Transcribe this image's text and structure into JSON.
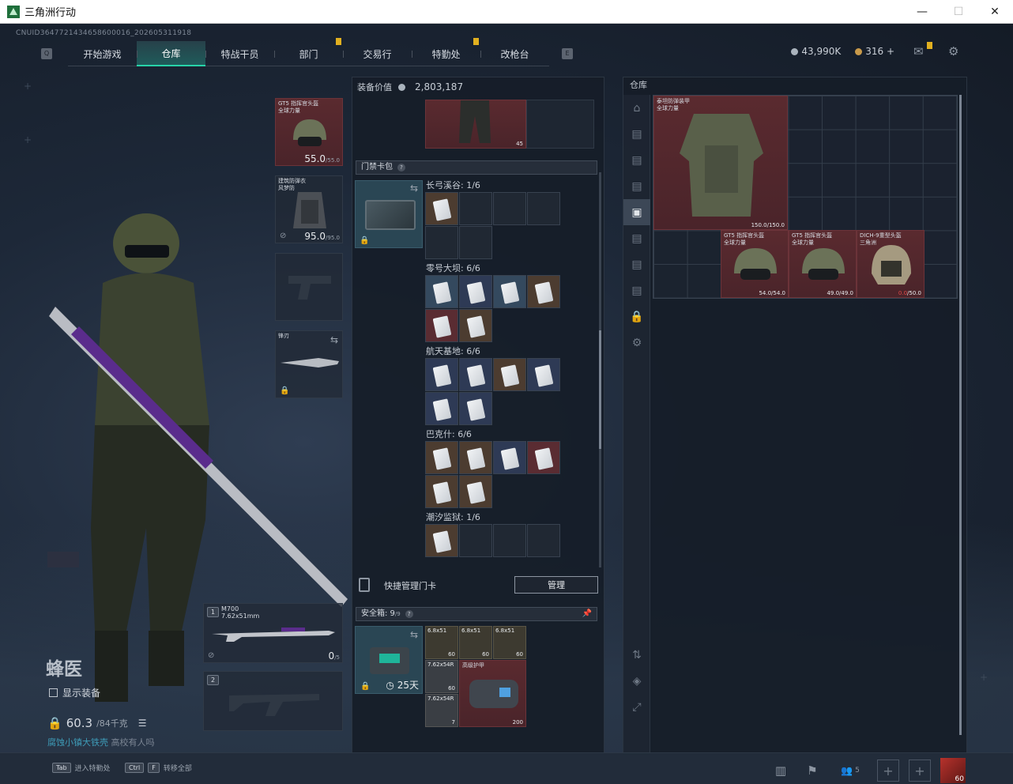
{
  "window": {
    "title": "三角洲行动",
    "minimize": "—",
    "maximize": "☐",
    "close": "✕"
  },
  "uid": "CNUID364772143465860001​6_202605311918",
  "nav": {
    "tabs": [
      {
        "label": "开始游戏",
        "badge": false
      },
      {
        "label": "仓库",
        "badge": false,
        "active": true
      },
      {
        "label": "特战干员",
        "badge": false
      },
      {
        "label": "部门",
        "badge": true
      },
      {
        "label": "交易行",
        "badge": false
      },
      {
        "label": "特勤处",
        "badge": true
      },
      {
        "label": "改枪台",
        "badge": false
      }
    ],
    "left_key": "Q",
    "right_key": "E"
  },
  "currency": {
    "silver": "43,990K",
    "gold": "316 +"
  },
  "character": {
    "name": "蜂医",
    "show_gear": "显示装备",
    "weight": "60.3",
    "weight_unit": "/84千克",
    "status": "腐蚀小镇大铁壳 ",
    "status_extra": "高校有人吗"
  },
  "gear": {
    "helmet": {
      "tag": "GT5 指挥官头盔\n全球力量",
      "dur": "55.0",
      "max": "/55.0"
    },
    "armor": {
      "tag": "建筑防弹衣\n风梦防",
      "dur": "95.0",
      "max": "/95.0"
    },
    "melee": {
      "tag": "锋刃"
    },
    "primary": {
      "tag": "M700",
      "sub": "7.62x51mm",
      "ammo": "0",
      "ammo_max": "/5",
      "slot_no": "1"
    },
    "secondary": {
      "slot_no": "2"
    }
  },
  "mid": {
    "title": "装备价值",
    "value": "2,803,187",
    "keycard_section": "门禁卡包",
    "maps": [
      {
        "label": "长弓溪谷: 1/6"
      },
      {
        "label": "零号大坝: 6/6"
      },
      {
        "label": "航天基地: 6/6"
      },
      {
        "label": "巴克什: 6/6"
      },
      {
        "label": "潮汐监狱: 1/6"
      }
    ],
    "top_count": "45",
    "manage_label": "快捷管理门卡",
    "manage_btn": "管理",
    "safe_title": "安全箱: 9",
    "safe_max": "/9",
    "safe_days": "25天",
    "ammo": [
      {
        "name": "6.8x51",
        "count": "60"
      },
      {
        "name": "6.8x51",
        "count": "60"
      },
      {
        "name": "6.8x51",
        "count": "60"
      },
      {
        "name": "7.62x54R",
        "count": "60"
      },
      {
        "name": "7.62x54R",
        "count": "7"
      }
    ],
    "safe_item": {
      "name": "高级护甲",
      "count": "200"
    }
  },
  "warehouse": {
    "title": "仓库",
    "items": [
      {
        "tag": "泰坦防弹装甲\n全球力量",
        "dur": "150.0/150.0"
      },
      {
        "tag": "GT5 指挥官头盔\n全球力量",
        "dur": "54.0/54.0"
      },
      {
        "tag": "GT5 指挥官头盔\n全球力量",
        "dur": "49.0/49.0"
      },
      {
        "tag": "DICH-9重型头盔\n三角洲",
        "dur_low": "0.0",
        "dur_max": "/50.0"
      }
    ]
  },
  "bottom": {
    "hint1_key": "Tab",
    "hint1": "进入特勤处",
    "hint2_key1": "Ctrl",
    "hint2_key2": "F",
    "hint2": "转移全部",
    "friends": "5",
    "level": "60"
  }
}
